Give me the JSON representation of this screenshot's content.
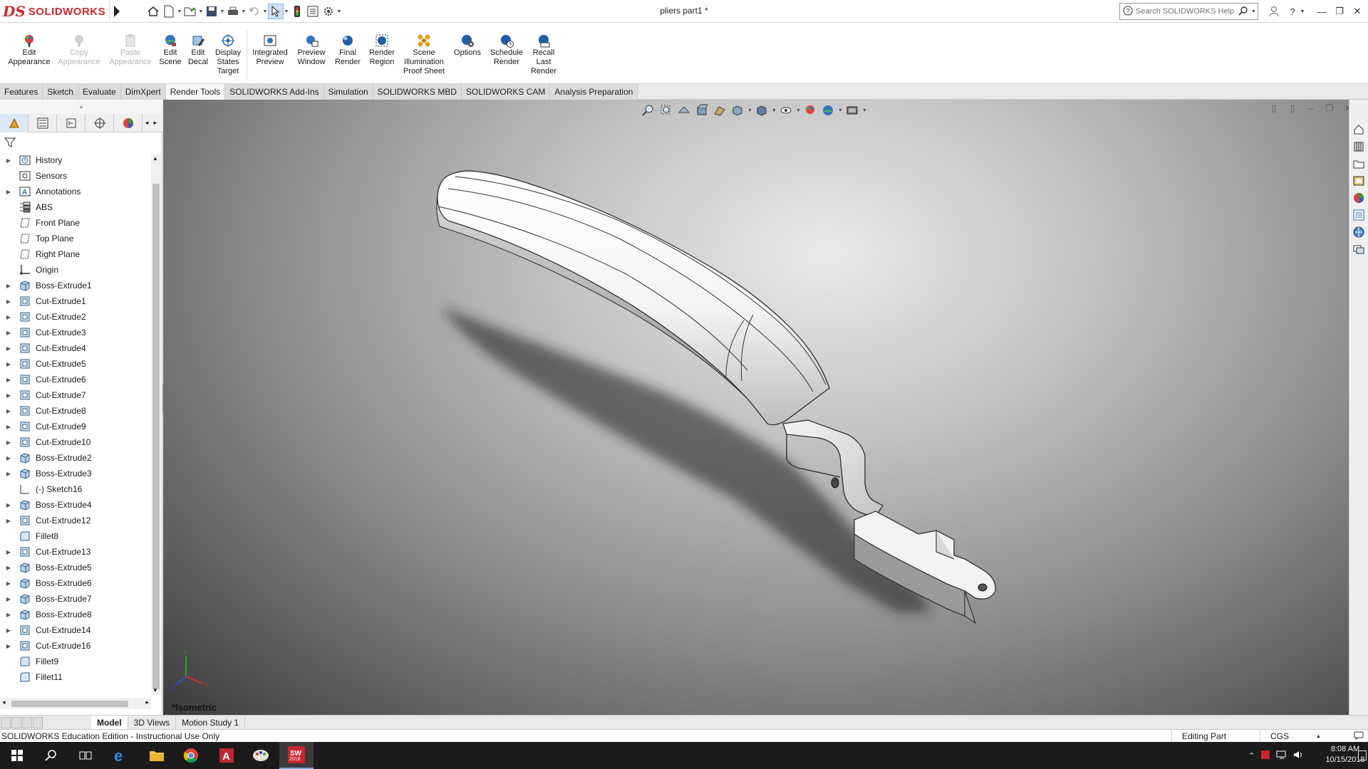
{
  "app": {
    "brand": "SOLIDWORKS",
    "brand_mark": "DS",
    "document_title": "pliers part1 *",
    "search_placeholder": "Search SOLIDWORKS Help",
    "colors": {
      "brand_red": "#d6262b",
      "active_blue": "#2b6cb0"
    }
  },
  "quick_access": [
    {
      "icon": "home-icon"
    },
    {
      "icon": "new-document-icon"
    },
    {
      "icon": "open-folder-icon"
    },
    {
      "icon": "save-icon"
    },
    {
      "icon": "print-icon"
    },
    {
      "icon": "undo-icon"
    },
    {
      "icon": "select-arrow-icon"
    },
    {
      "icon": "rebuild-traffic-light-icon"
    },
    {
      "icon": "file-properties-icon"
    },
    {
      "icon": "options-gear-icon"
    }
  ],
  "commands": [
    {
      "label1": "Edit",
      "label2": "Appearance",
      "label3": "",
      "icon": "edit-appearance-icon",
      "enabled": true
    },
    {
      "label1": "Copy",
      "label2": "Appearance",
      "label3": "",
      "icon": "copy-appearance-icon",
      "enabled": false
    },
    {
      "label1": "Paste",
      "label2": "Appearance",
      "label3": "",
      "icon": "paste-appearance-icon",
      "enabled": false
    },
    {
      "label1": "Edit",
      "label2": "Scene",
      "label3": "",
      "icon": "edit-scene-icon",
      "enabled": true
    },
    {
      "label1": "Edit",
      "label2": "Decal",
      "label3": "",
      "icon": "edit-decal-icon",
      "enabled": true
    },
    {
      "label1": "Display",
      "label2": "States",
      "label3": "Target",
      "icon": "display-states-target-icon",
      "enabled": true
    },
    {
      "label1": "Integrated",
      "label2": "Preview",
      "label3": "",
      "icon": "integrated-preview-icon",
      "enabled": true
    },
    {
      "label1": "Preview",
      "label2": "Window",
      "label3": "",
      "icon": "preview-window-icon",
      "enabled": true
    },
    {
      "label1": "Final",
      "label2": "Render",
      "label3": "",
      "icon": "final-render-icon",
      "enabled": true
    },
    {
      "label1": "Render",
      "label2": "Region",
      "label3": "",
      "icon": "render-region-icon",
      "enabled": true
    },
    {
      "label1": "Scene",
      "label2": "Illumination",
      "label3": "Proof Sheet",
      "icon": "scene-illumination-icon",
      "enabled": true
    },
    {
      "label1": "Options",
      "label2": "",
      "label3": "",
      "icon": "render-options-icon",
      "enabled": true
    },
    {
      "label1": "Schedule",
      "label2": "Render",
      "label3": "",
      "icon": "schedule-render-icon",
      "enabled": true
    },
    {
      "label1": "Recall",
      "label2": "Last",
      "label3": "Render",
      "icon": "recall-last-render-icon",
      "enabled": true
    }
  ],
  "tabs": [
    {
      "label": "Features"
    },
    {
      "label": "Sketch"
    },
    {
      "label": "Evaluate"
    },
    {
      "label": "DimXpert"
    },
    {
      "label": "Render Tools",
      "active": true
    },
    {
      "label": "SOLIDWORKS Add-Ins"
    },
    {
      "label": "Simulation"
    },
    {
      "label": "SOLIDWORKS MBD"
    },
    {
      "label": "SOLIDWORKS CAM"
    },
    {
      "label": "Analysis Preparation"
    }
  ],
  "panel_tabs": [
    {
      "icon": "featuremanager-tree-icon"
    },
    {
      "icon": "propertymanager-icon"
    },
    {
      "icon": "configurationmanager-icon"
    },
    {
      "icon": "dimxpertmanager-icon"
    },
    {
      "icon": "displaymanager-icon"
    }
  ],
  "tree": [
    {
      "label": "History",
      "icon": "history-folder-icon",
      "expandable": true
    },
    {
      "label": "Sensors",
      "icon": "sensors-icon",
      "expandable": false
    },
    {
      "label": "Annotations",
      "icon": "annotations-icon",
      "expandable": true
    },
    {
      "label": "ABS",
      "icon": "material-icon",
      "expandable": false
    },
    {
      "label": "Front Plane",
      "icon": "plane-icon",
      "expandable": false
    },
    {
      "label": "Top Plane",
      "icon": "plane-icon",
      "expandable": false
    },
    {
      "label": "Right Plane",
      "icon": "plane-icon",
      "expandable": false
    },
    {
      "label": "Origin",
      "icon": "origin-icon",
      "expandable": false
    },
    {
      "label": "Boss-Extrude1",
      "icon": "boss-extrude-icon",
      "expandable": true
    },
    {
      "label": "Cut-Extrude1",
      "icon": "cut-extrude-icon",
      "expandable": true
    },
    {
      "label": "Cut-Extrude2",
      "icon": "cut-extrude-icon",
      "expandable": true
    },
    {
      "label": "Cut-Extrude3",
      "icon": "cut-extrude-icon",
      "expandable": true
    },
    {
      "label": "Cut-Extrude4",
      "icon": "cut-extrude-icon",
      "expandable": true
    },
    {
      "label": "Cut-Extrude5",
      "icon": "cut-extrude-icon",
      "expandable": true
    },
    {
      "label": "Cut-Extrude6",
      "icon": "cut-extrude-icon",
      "expandable": true
    },
    {
      "label": "Cut-Extrude7",
      "icon": "cut-extrude-icon",
      "expandable": true
    },
    {
      "label": "Cut-Extrude8",
      "icon": "cut-extrude-icon",
      "expandable": true
    },
    {
      "label": "Cut-Extrude9",
      "icon": "cut-extrude-icon",
      "expandable": true
    },
    {
      "label": "Cut-Extrude10",
      "icon": "cut-extrude-icon",
      "expandable": true
    },
    {
      "label": "Boss-Extrude2",
      "icon": "boss-extrude-icon",
      "expandable": true
    },
    {
      "label": "Boss-Extrude3",
      "icon": "boss-extrude-icon",
      "expandable": true
    },
    {
      "label": "(-) Sketch16",
      "icon": "sketch-icon",
      "expandable": false
    },
    {
      "label": "Boss-Extrude4",
      "icon": "boss-extrude-icon",
      "expandable": true
    },
    {
      "label": "Cut-Extrude12",
      "icon": "cut-extrude-icon",
      "expandable": true
    },
    {
      "label": "Fillet8",
      "icon": "fillet-icon",
      "expandable": false
    },
    {
      "label": "Cut-Extrude13",
      "icon": "cut-extrude-icon",
      "expandable": true
    },
    {
      "label": "Boss-Extrude5",
      "icon": "boss-extrude-icon",
      "expandable": true
    },
    {
      "label": "Boss-Extrude6",
      "icon": "boss-extrude-icon",
      "expandable": true
    },
    {
      "label": "Boss-Extrude7",
      "icon": "boss-extrude-icon",
      "expandable": true
    },
    {
      "label": "Boss-Extrude8",
      "icon": "boss-extrude-icon",
      "expandable": true
    },
    {
      "label": "Cut-Extrude14",
      "icon": "cut-extrude-icon",
      "expandable": true
    },
    {
      "label": "Cut-Extrude16",
      "icon": "cut-extrude-icon",
      "expandable": true
    },
    {
      "label": "Fillet9",
      "icon": "fillet-icon",
      "expandable": false
    },
    {
      "label": "Fillet11",
      "icon": "fillet-icon",
      "expandable": false
    }
  ],
  "heads_up": [
    {
      "icon": "zoom-to-fit-icon"
    },
    {
      "icon": "zoom-to-area-icon"
    },
    {
      "icon": "previous-view-icon"
    },
    {
      "icon": "section-view-icon"
    },
    {
      "icon": "dynamic-annotation-icon"
    },
    {
      "icon": "view-orientation-icon"
    },
    {
      "icon": "display-style-icon"
    },
    {
      "icon": "hide-show-items-icon"
    },
    {
      "icon": "edit-appearance-icon"
    },
    {
      "icon": "apply-scene-icon"
    },
    {
      "icon": "view-settings-icon"
    }
  ],
  "viewport": {
    "view_label": "*Isometric",
    "triad_axes": {
      "x": "X",
      "y": "Y",
      "z": "Z"
    }
  },
  "task_pane": [
    {
      "icon": "solidworks-resources-icon"
    },
    {
      "icon": "design-library-icon"
    },
    {
      "icon": "file-explorer-icon"
    },
    {
      "icon": "view-palette-icon"
    },
    {
      "icon": "appearances-scenes-icon"
    },
    {
      "icon": "custom-properties-icon"
    },
    {
      "icon": "solidworks-forum-icon"
    },
    {
      "icon": "3dexperience-icon"
    }
  ],
  "model_tabs": [
    {
      "label": "Model",
      "active": true
    },
    {
      "label": "3D Views"
    },
    {
      "label": "Motion Study 1"
    }
  ],
  "status": {
    "left": "SOLIDWORKS Education Edition - Instructional Use Only",
    "mode": "Editing Part",
    "units": "CGS",
    "units_arrow": "▲"
  },
  "taskbar": {
    "apps": [
      {
        "icon": "windows-start-icon"
      },
      {
        "icon": "search-icon"
      },
      {
        "icon": "task-view-icon"
      },
      {
        "icon": "edge-browser-icon"
      },
      {
        "icon": "file-explorer-icon"
      },
      {
        "icon": "chrome-icon"
      },
      {
        "icon": "autocad-icon"
      },
      {
        "icon": "paint-icon"
      },
      {
        "icon": "solidworks-2018-icon",
        "badge": "2018",
        "active": true
      }
    ],
    "time": "8:08 AM",
    "date": "10/15/2018"
  }
}
